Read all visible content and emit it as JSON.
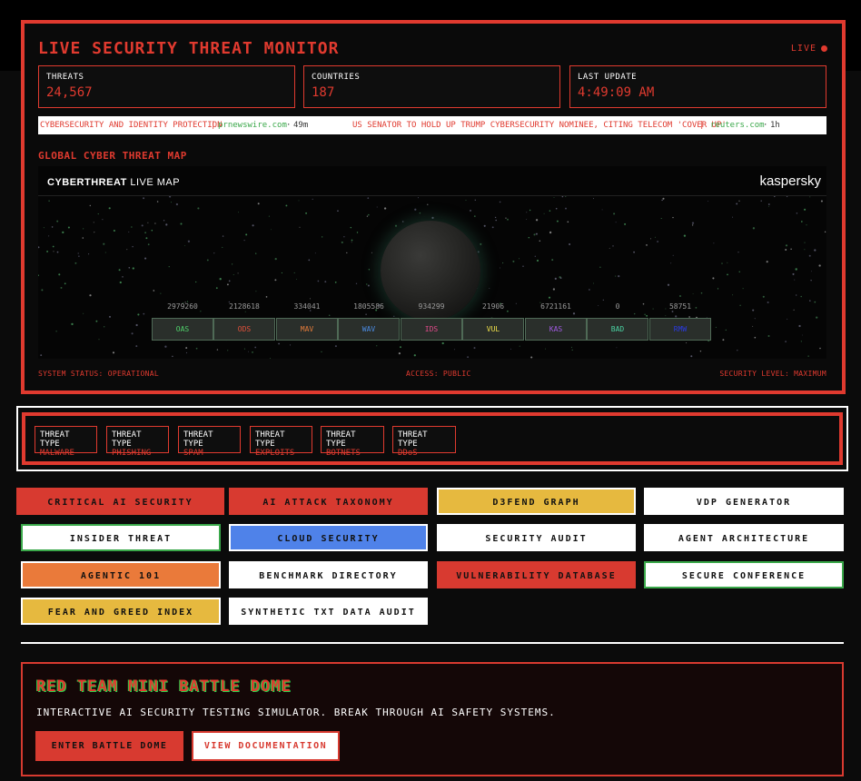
{
  "monitor": {
    "title": "LIVE SECURITY THREAT MONITOR",
    "live_label": "LIVE",
    "stats": [
      {
        "label": "THREATS",
        "value": "24,567"
      },
      {
        "label": "COUNTRIES",
        "value": "187"
      },
      {
        "label": "LAST UPDATE",
        "value": "4:49:09 AM"
      }
    ],
    "ticker": {
      "headline1": "CYBERSECURITY AND IDENTITY PROTECTION",
      "source1": "prnewswire.com",
      "time1": "49m",
      "headline2": "US SENATOR TO HOLD UP TRUMP CYBERSECURITY NOMINEE, CITING TELECOM 'COVER UP'",
      "source2": "reuters.com",
      "time2": "1h",
      "sep": "|",
      "dot": "·"
    },
    "map_heading": "GLOBAL CYBER THREAT MAP",
    "map": {
      "title_bold": "CYBERTHREAT",
      "title_rest": " LIVE MAP",
      "brand": "kaspersky",
      "counts": [
        "2979260",
        "2128618",
        "334041",
        "1805586",
        "934299",
        "21906",
        "6721161",
        "0",
        "58751"
      ],
      "categories": [
        {
          "label": "OAS",
          "color": "#4fcf6a"
        },
        {
          "label": "ODS",
          "color": "#e0503a"
        },
        {
          "label": "MAV",
          "color": "#e07a3a"
        },
        {
          "label": "WAV",
          "color": "#4a8ae0"
        },
        {
          "label": "IDS",
          "color": "#e04a8a"
        },
        {
          "label": "VUL",
          "color": "#f0e04a"
        },
        {
          "label": "KAS",
          "color": "#a05ae0"
        },
        {
          "label": "BAD",
          "color": "#4acfa0"
        },
        {
          "label": "RMW",
          "color": "#2a3ae0"
        }
      ]
    },
    "footer": {
      "status": "SYSTEM STATUS: OPERATIONAL",
      "access": "ACCESS: PUBLIC",
      "level": "SECURITY LEVEL: MAXIMUM"
    }
  },
  "threat_types": [
    {
      "label": "THREAT TYPE",
      "value": "MALWARE"
    },
    {
      "label": "THREAT TYPE",
      "value": "PHISHING"
    },
    {
      "label": "THREAT TYPE",
      "value": "SPAM"
    },
    {
      "label": "THREAT TYPE",
      "value": "EXPLOITS"
    },
    {
      "label": "THREAT TYPE",
      "value": "BOTNETS"
    },
    {
      "label": "THREAT TYPE",
      "value": "DDoS"
    }
  ],
  "buttons": [
    {
      "label": "CRITICAL AI SECURITY"
    },
    {
      "label": "AI ATTACK TAXONOMY"
    },
    {
      "label": "D3FEND GRAPH"
    },
    {
      "label": "VDP GENERATOR"
    },
    {
      "label": "INSIDER THREAT"
    },
    {
      "label": "CLOUD SECURITY"
    },
    {
      "label": "SECURITY AUDIT"
    },
    {
      "label": "AGENT ARCHITECTURE"
    },
    {
      "label": "AGENTIC 101"
    },
    {
      "label": "BENCHMARK DIRECTORY"
    },
    {
      "label": "VULNERABILITY DATABASE"
    },
    {
      "label": "SECURE CONFERENCE"
    },
    {
      "label": "FEAR AND GREED INDEX"
    },
    {
      "label": "SYNTHETIC TXT DATA AUDIT"
    }
  ],
  "dome": {
    "title": "RED TEAM MINI BATTLE DOME",
    "subtitle": "INTERACTIVE AI SECURITY TESTING SIMULATOR. BREAK THROUGH AI SAFETY SYSTEMS.",
    "enter_label": "ENTER BATTLE DOME",
    "docs_label": "VIEW DOCUMENTATION"
  }
}
